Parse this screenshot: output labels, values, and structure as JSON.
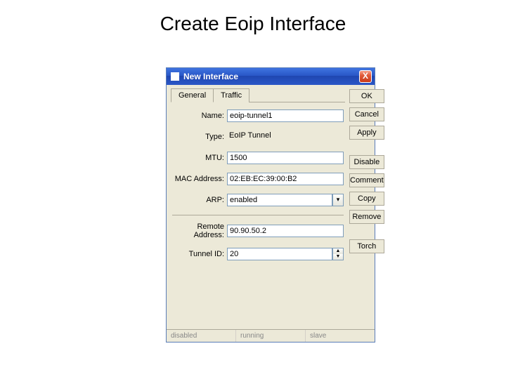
{
  "page": {
    "title": "Create Eoip Interface"
  },
  "window": {
    "title": "New Interface",
    "close_glyph": "X"
  },
  "tabs": {
    "general": "General",
    "traffic": "Traffic"
  },
  "form": {
    "labels": {
      "name": "Name:",
      "type": "Type:",
      "mtu": "MTU:",
      "mac": "MAC Address:",
      "arp": "ARP:",
      "remote": "Remote Address:",
      "tunnelid": "Tunnel ID:"
    },
    "values": {
      "name": "eoip-tunnel1",
      "type": "EoIP Tunnel",
      "mtu": "1500",
      "mac": "02:EB:EC:39:00:B2",
      "arp": "enabled",
      "remote": "90.90.50.2",
      "tunnelid": "20"
    }
  },
  "buttons": {
    "ok": "OK",
    "cancel": "Cancel",
    "apply": "Apply",
    "disable": "Disable",
    "comment": "Comment",
    "copy": "Copy",
    "remove": "Remove",
    "torch": "Torch"
  },
  "status": {
    "disabled": "disabled",
    "running": "running",
    "slave": "slave"
  }
}
